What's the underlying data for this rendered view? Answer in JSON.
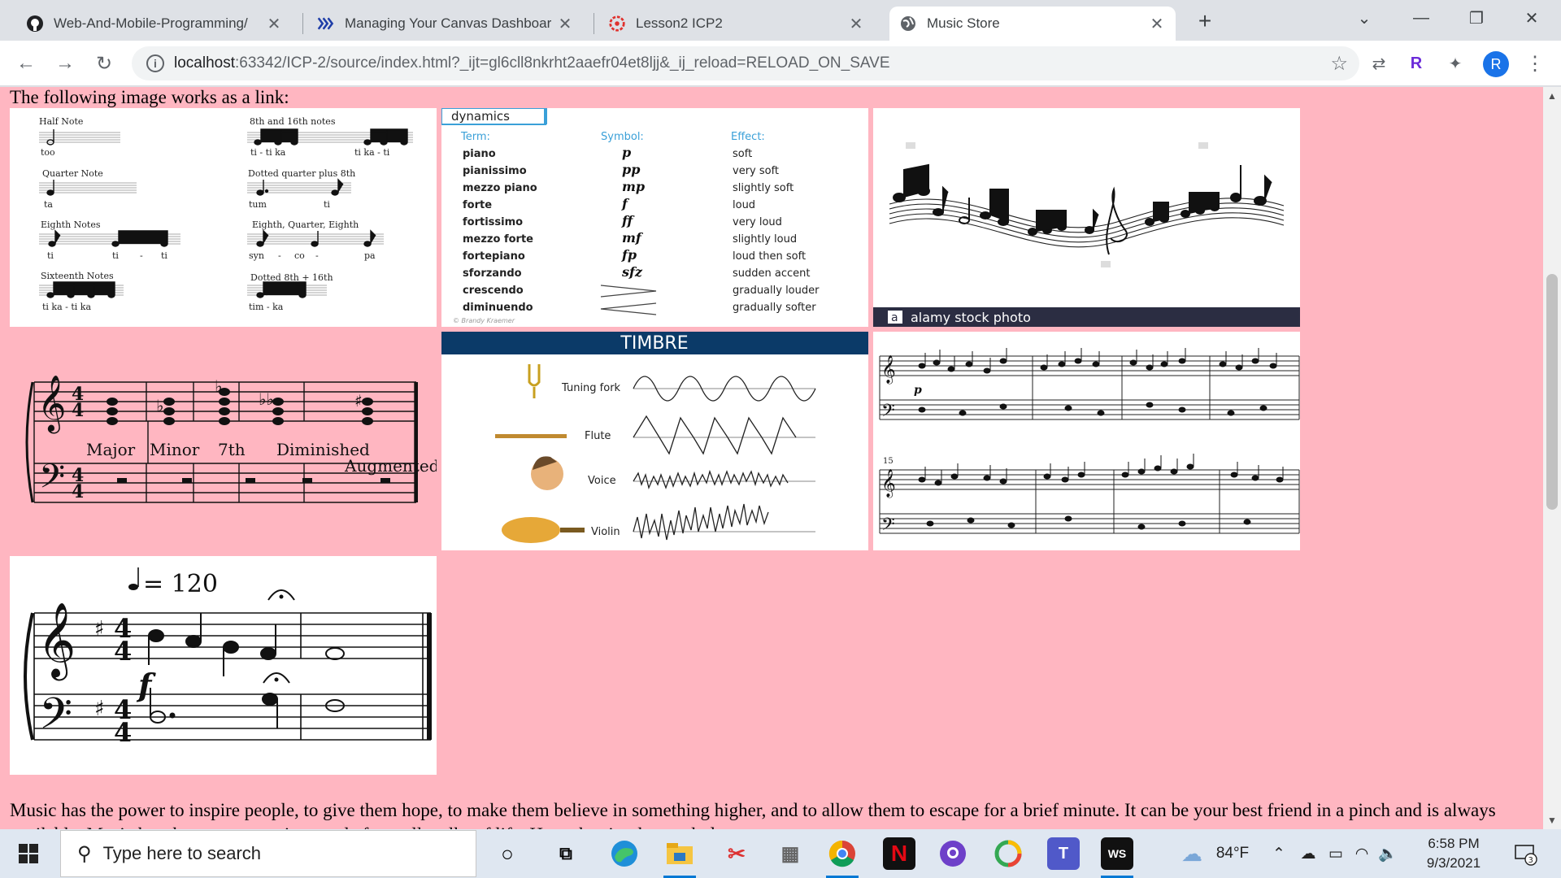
{
  "tabs": [
    {
      "title": "Web-And-Mobile-Programming/",
      "icon": "github-icon"
    },
    {
      "title": "Managing Your Canvas Dashboar",
      "icon": "canvas-icon"
    },
    {
      "title": "Lesson2 ICP2",
      "icon": "canvas-red-icon"
    },
    {
      "title": "Music Store",
      "icon": "globe-icon",
      "active": true
    }
  ],
  "toolbar": {
    "url_host": "localhost",
    "url_rest": ":63342/ICP-2/source/index.html?_ijt=gl6cll8nkrht2aaefr04et8ljj&_ij_reload=RELOAD_ON_SAVE",
    "profile_initial": "R"
  },
  "page": {
    "intro": "The following image works as a link:",
    "paragraph": "Music has the power to inspire people, to give them hope, to make them believe in something higher, and to allow them to escape for a brief minute. It can be your best friend in a pinch and is always available. Music has the power to unite people from all walks of life. Have the simplest melody...",
    "note_values": {
      "half_note": "Half Note",
      "half_syl": "too",
      "quarter_note": "Quarter Note",
      "quarter_syl": "ta",
      "eighth_notes": "Eighth Notes",
      "eighth_syl": [
        "ti",
        "ti",
        "-",
        "ti"
      ],
      "sixteenth_notes": "Sixteenth Notes",
      "sixteenth_syl": "ti  ka - ti  ka",
      "e16": "8th and 16th notes",
      "e16_syl_a": "ti - ti ka",
      "e16_syl_b": "ti ka - ti",
      "dotted_q": "Dotted quarter plus 8th",
      "dotted_q_syl_a": "tum",
      "dotted_q_syl_b": "ti",
      "eqe": "Eighth, Quarter, Eighth",
      "eqe_syl": [
        "syn",
        "-",
        "co",
        "-",
        "pa"
      ],
      "dotted8": "Dotted 8th + 16th",
      "dotted8_syl": "tim  -  ka"
    },
    "dynamics": {
      "title": "dynamics",
      "headers": [
        "Term:",
        "Symbol:",
        "Effect:"
      ],
      "rows": [
        [
          "piano",
          "p",
          "soft"
        ],
        [
          "pianissimo",
          "pp",
          "very soft"
        ],
        [
          "mezzo piano",
          "mp",
          "slightly soft"
        ],
        [
          "forte",
          "f",
          "loud"
        ],
        [
          "fortissimo",
          "ff",
          "very loud"
        ],
        [
          "mezzo forte",
          "mf",
          "slightly loud"
        ],
        [
          "fortepiano",
          "fp",
          "loud then soft"
        ],
        [
          "sforzando",
          "sfz",
          "sudden accent"
        ],
        [
          "crescendo",
          "<",
          "gradually louder"
        ],
        [
          "diminuendo",
          ">",
          "gradually softer"
        ]
      ],
      "credit": "© Brandy Kraemer"
    },
    "stock": {
      "badge": "a",
      "caption": "alamy stock photo"
    },
    "chords": {
      "labels": [
        "Major",
        "Minor",
        "7th",
        "Diminished",
        "Augmented"
      ]
    },
    "timbre": {
      "title": "TIMBRE",
      "rows": [
        "Tuning fork",
        "Flute",
        "Voice",
        "Violin"
      ]
    },
    "score": {
      "measure_number": "15",
      "dynamic": "p"
    },
    "tempo": {
      "mark": "= 120",
      "dynamic": "f"
    }
  },
  "taskbar": {
    "search_placeholder": "Type here to search",
    "temperature": "84°F",
    "time": "6:58 PM",
    "date": "9/3/2021",
    "notifications": "3",
    "colors": {
      "accent": "#0078d4"
    }
  }
}
